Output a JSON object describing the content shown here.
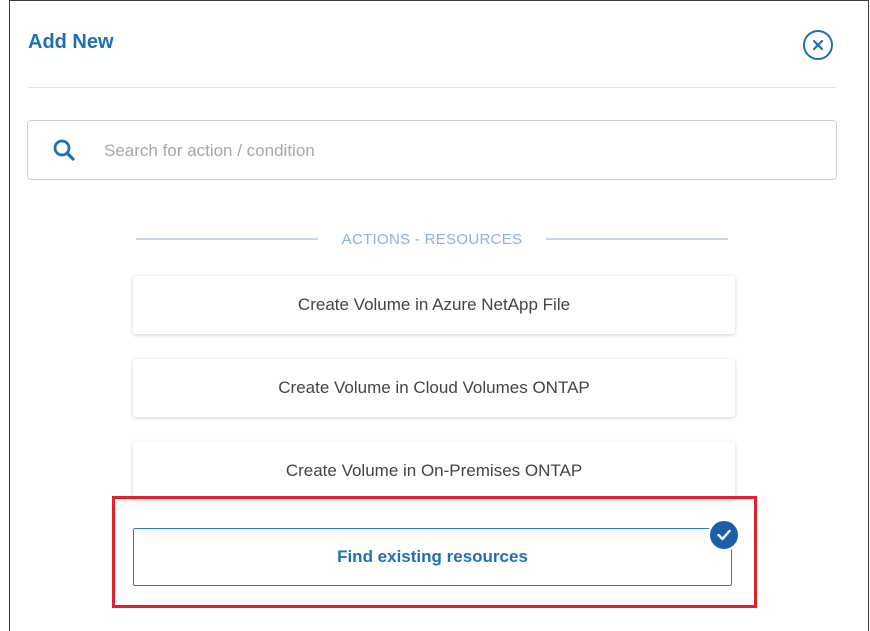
{
  "dialog": {
    "title": "Add New",
    "close_icon": "close-icon"
  },
  "search": {
    "placeholder": "Search for action / condition",
    "value": "",
    "icon": "search-icon"
  },
  "section": {
    "label": "ACTIONS - RESOURCES"
  },
  "actions": [
    {
      "label": "Create Volume in Azure NetApp File"
    },
    {
      "label": "Create Volume in Cloud Volumes ONTAP"
    },
    {
      "label": "Create Volume in On-Premises ONTAP"
    }
  ],
  "selected_action": {
    "label": "Find existing resources",
    "badge_icon": "checkmark-icon"
  },
  "colors": {
    "accent": "#1f6fb5",
    "highlight": "#e0202a",
    "section_label": "#8fb0d6",
    "badge": "#1c5fa8"
  }
}
